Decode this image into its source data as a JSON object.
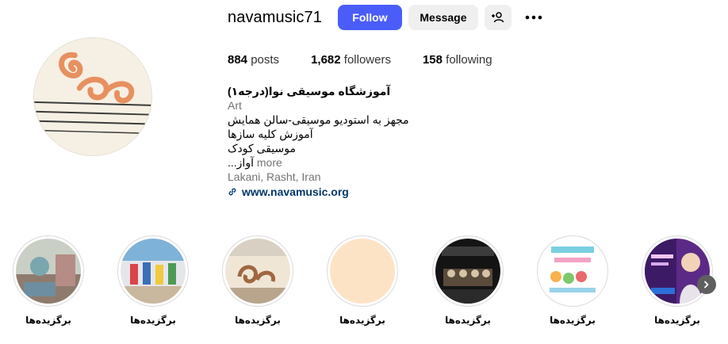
{
  "profile": {
    "username": "navamusic71",
    "follow_label": "Follow",
    "message_label": "Message",
    "add_user_icon": "person-add-icon",
    "more_icon": "more-horizontal-icon"
  },
  "stats": {
    "posts_count": "884",
    "posts_label": "posts",
    "followers_count": "1,682",
    "followers_label": "followers",
    "following_count": "158",
    "following_label": "following"
  },
  "bio": {
    "name": "آموزشگاه موسیقی نوا(درجه۱)",
    "category": "Art",
    "lines": [
      "مجهز به استودیو موسیقی-سالن همایش",
      "آموزش کلیه سازها",
      "موسیقی کودک",
      "آواز..."
    ],
    "more_label": "more",
    "location": "Lakani, Rasht, Iran",
    "link": "www.navamusic.org"
  },
  "highlights": [
    {
      "label": "برگزیده‌ها"
    },
    {
      "label": "برگزیده‌ها"
    },
    {
      "label": "برگزیده‌ها"
    },
    {
      "label": "برگزیده‌ها"
    },
    {
      "label": "برگزیده‌ها"
    },
    {
      "label": "برگزیده‌ها"
    },
    {
      "label": "برگزیده‌ها"
    }
  ],
  "colors": {
    "follow_button": "#4a5df9",
    "secondary_button": "#efefef",
    "link": "#00376b",
    "muted": "#737373"
  }
}
